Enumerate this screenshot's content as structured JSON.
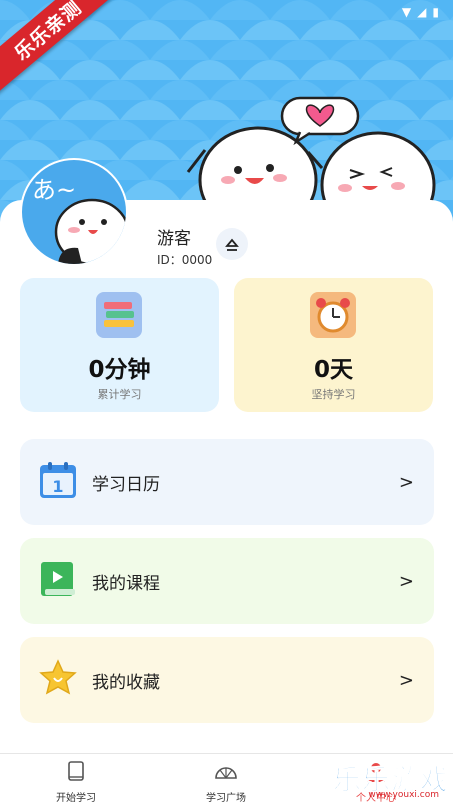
{
  "status": {
    "icons": [
      "wifi-icon",
      "signal-icon",
      "battery-icon"
    ]
  },
  "ribbon": {
    "text": "乐乐亲测"
  },
  "hero": {
    "avatar_text": "あ~"
  },
  "profile": {
    "name": "游客",
    "id_text": "ID：0000"
  },
  "stats": [
    {
      "value": "0分钟",
      "label": "累计学习",
      "icon": "books-icon"
    },
    {
      "value": "0天",
      "label": "坚持学习",
      "icon": "alarm-clock-icon"
    }
  ],
  "menu": [
    {
      "label": "学习日历",
      "icon": "calendar-icon"
    },
    {
      "label": "我的课程",
      "icon": "course-book-icon"
    },
    {
      "label": "我的收藏",
      "icon": "star-icon"
    }
  ],
  "menu_arrow": ">",
  "tabs": [
    {
      "label": "开始学习",
      "icon": "book-tab-icon"
    },
    {
      "label": "学习广场",
      "icon": "fan-tab-icon"
    },
    {
      "label": "个人中心",
      "icon": "profile-tab-icon"
    }
  ],
  "watermark": {
    "text": "乐乐游戏",
    "url": "www.youxi.com"
  },
  "colors": {
    "hero_blue": "#52b6f4",
    "ribbon_red": "#d9262c",
    "stat_blue": "#e2f3fe",
    "stat_yellow": "#fdf4cf"
  }
}
